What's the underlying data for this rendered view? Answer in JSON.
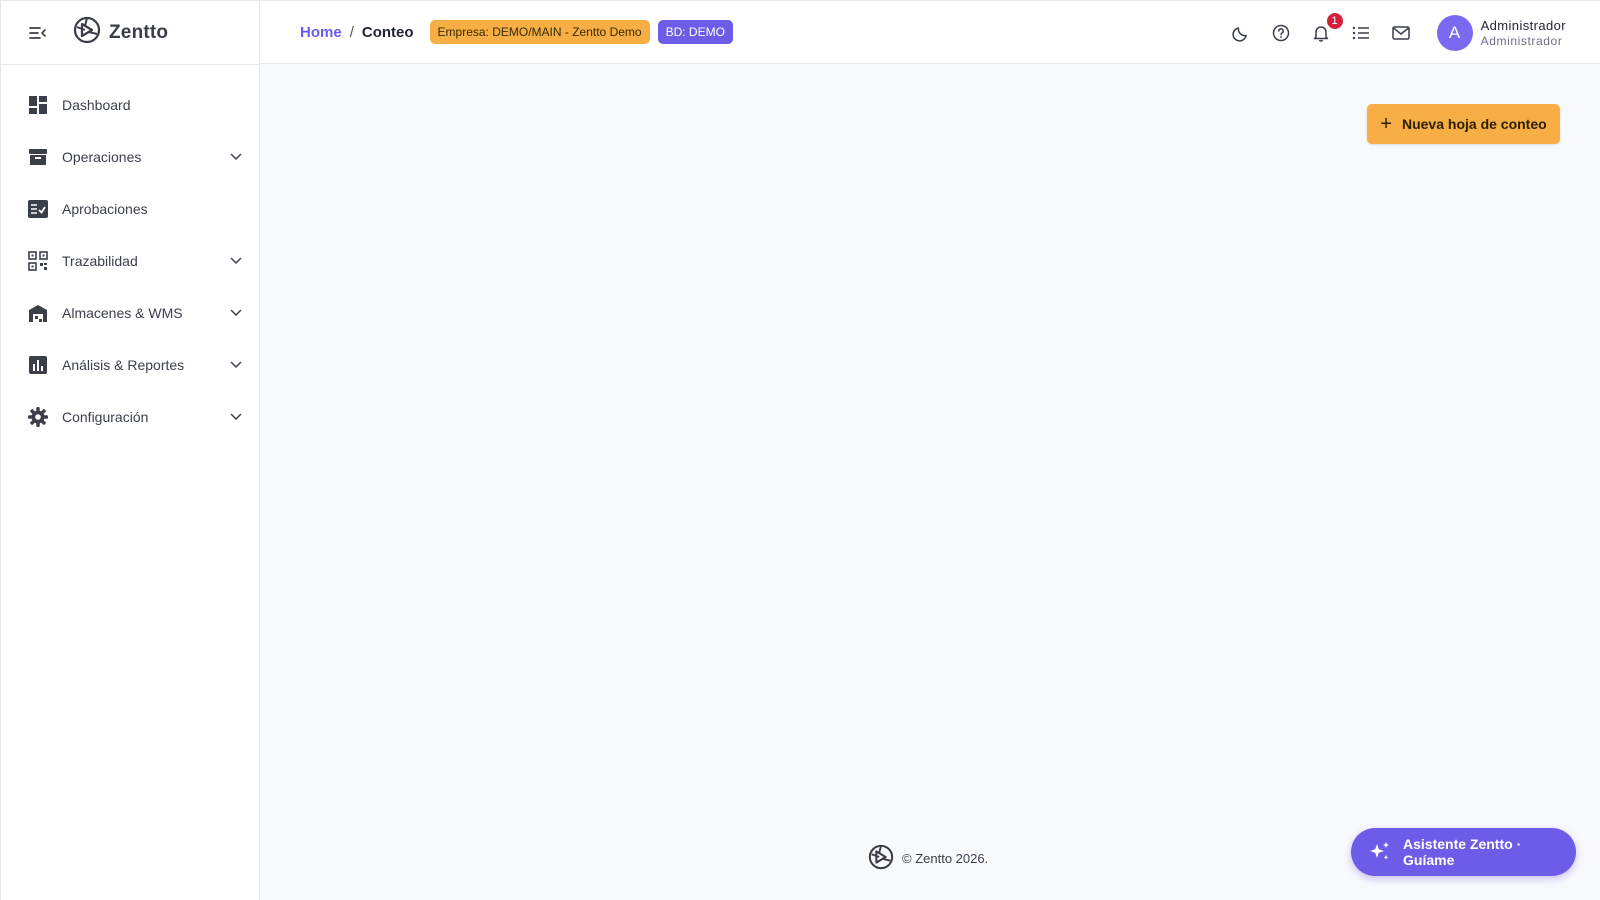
{
  "brand": {
    "name": "Zentto"
  },
  "sidebar": {
    "items": [
      {
        "label": "Dashboard",
        "icon": "dashboard-icon",
        "expandable": false
      },
      {
        "label": "Operaciones",
        "icon": "archive-box-icon",
        "expandable": true
      },
      {
        "label": "Aprobaciones",
        "icon": "checklist-icon",
        "expandable": false
      },
      {
        "label": "Trazabilidad",
        "icon": "qr-code-icon",
        "expandable": true
      },
      {
        "label": "Almacenes & WMS",
        "icon": "warehouse-icon",
        "expandable": true
      },
      {
        "label": "Análisis & Reportes",
        "icon": "bar-chart-icon",
        "expandable": true
      },
      {
        "label": "Configuración",
        "icon": "gear-icon",
        "expandable": true
      }
    ]
  },
  "header": {
    "breadcrumb": {
      "home": "Home",
      "separator": "/",
      "current": "Conteo"
    },
    "company_badge": "Empresa: DEMO/MAIN - Zentto Demo",
    "db_badge": "BD: DEMO",
    "notifications_count": "1",
    "user": {
      "initial": "A",
      "name": "Administrador",
      "role": "Administrador"
    }
  },
  "main": {
    "new_sheet_button": {
      "icon": "+",
      "label": "Nueva hoja de conteo"
    }
  },
  "footer": {
    "copyright": "© Zentto 2026."
  },
  "assistant": {
    "label": "Asistente Zentto · Guíame"
  },
  "colors": {
    "accent": "#6c5ce7",
    "warning": "#f6ae45",
    "notification": "#d3203c",
    "background": "#f8f9fb"
  }
}
